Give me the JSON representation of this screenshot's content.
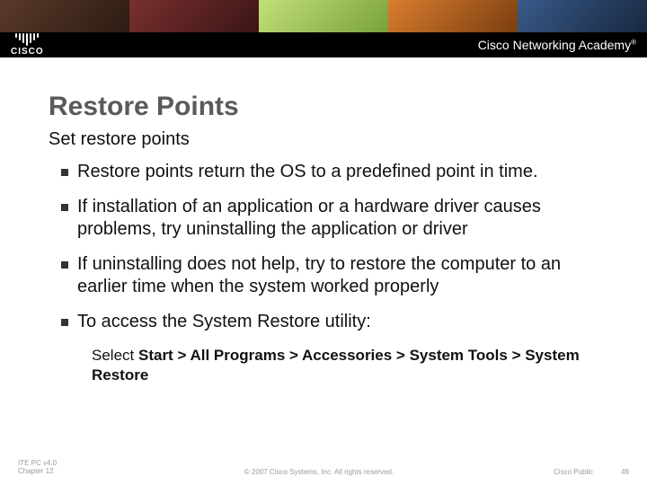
{
  "banner": {
    "logo_text": "CISCO",
    "academy": "Cisco Networking Academy",
    "tm": "®"
  },
  "title": "Restore Points",
  "subtitle": "Set restore points",
  "bullets": [
    "Restore points return the OS to a predefined point in time.",
    "If installation of an application or a hardware driver causes problems, try uninstalling the application or driver",
    "If uninstalling does not help, try to restore the computer to an earlier time when the system worked properly",
    "To access the System Restore utility:"
  ],
  "substep": {
    "lead": "Select ",
    "path": "Start > All Programs > Accessories > System Tools > System Restore"
  },
  "footer": {
    "left_line1": "ITE PC v4.0",
    "left_line2": "Chapter 12",
    "center": "© 2007 Cisco Systems, Inc. All rights reserved.",
    "right1": "Cisco Public",
    "right2": "49"
  }
}
